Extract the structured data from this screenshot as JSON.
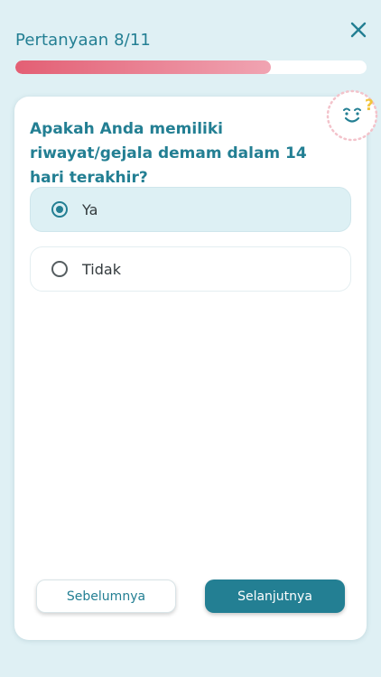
{
  "header": {
    "title": "Pertanyaan 8/11",
    "progress": {
      "current": 8,
      "total": 11
    },
    "close_icon": "close-icon"
  },
  "question": {
    "text": "Apakah Anda memiliki riwayat/gejala demam dalam 14 hari terakhir?",
    "options": [
      {
        "label": "Ya",
        "selected": true
      },
      {
        "label": "Tidak",
        "selected": false
      }
    ]
  },
  "mascot": {
    "icon": "question-mascot-icon",
    "symbol": "?"
  },
  "footer": {
    "prev_label": "Sebelumnya",
    "next_label": "Selanjutnya"
  },
  "colors": {
    "background": "#dff0f4",
    "accent": "#237f93",
    "progress_start": "#e35f74",
    "progress_end": "#f0a4b2",
    "mascot_question": "#f2c53d"
  }
}
